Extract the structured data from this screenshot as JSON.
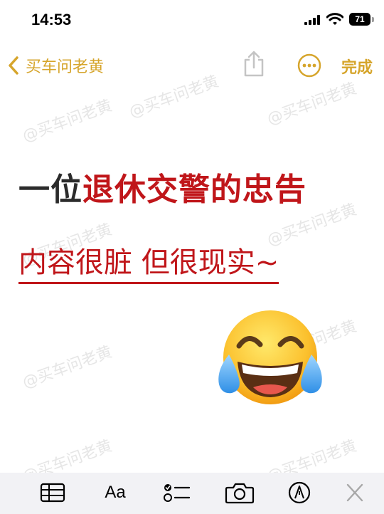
{
  "status_bar": {
    "time": "14:53",
    "battery_level": "71"
  },
  "nav": {
    "back_label": "买车问老黄",
    "done_label": "完成"
  },
  "watermark": {
    "text": "@买车问老黄"
  },
  "note": {
    "headline_part1": "一位",
    "headline_part2": "退休交警的忠告",
    "subline": "内容很脏 但很现实~"
  },
  "toolbar": {
    "format_label": "Aa"
  },
  "icons": {
    "back": "chevron-left-icon",
    "share": "share-icon",
    "more": "ellipsis-circle-icon",
    "table": "table-icon",
    "checklist": "checklist-icon",
    "camera": "camera-icon",
    "markup": "pen-tip-icon",
    "close": "close-icon",
    "emoji": "face-with-tears-of-joy"
  },
  "colors": {
    "accent": "#d6a52c",
    "headline_red": "#c0161a",
    "headline_dark": "#2b2b2b",
    "toolbar_bg": "#f2f2f5"
  }
}
